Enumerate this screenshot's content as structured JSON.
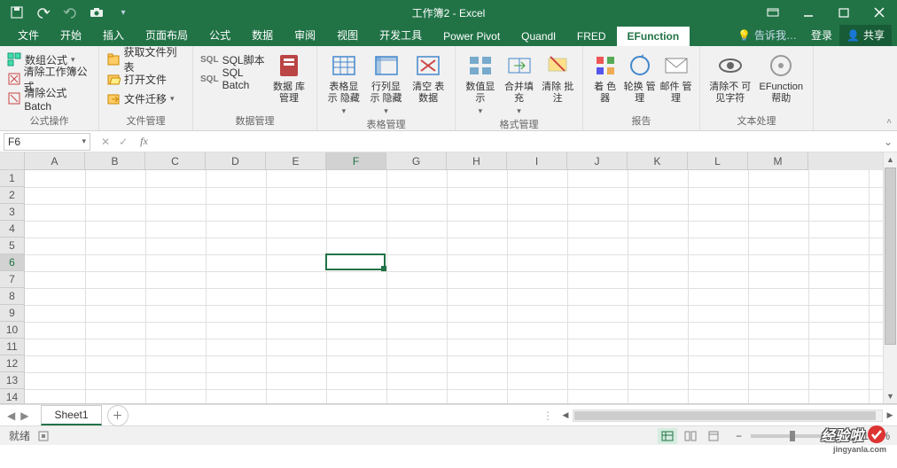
{
  "titlebar": {
    "title": "工作簿2 - Excel"
  },
  "tabs": {
    "file": "文件",
    "home": "开始",
    "insert": "插入",
    "layout": "页面布局",
    "formula": "公式",
    "data": "数据",
    "review": "审阅",
    "view": "视图",
    "dev": "开发工具",
    "powerpivot": "Power Pivot",
    "quandl": "Quandl",
    "fred": "FRED",
    "efunction": "EFunction",
    "tellme": "告诉我…",
    "login": "登录",
    "share": "共享"
  },
  "ribbon": {
    "g1": {
      "b1": "数组公式",
      "b2": "清除工作簿公式",
      "b3": "清除公式Batch",
      "label": "公式操作"
    },
    "g2": {
      "b1": "获取文件列表",
      "b2": "打开文件",
      "b3": "文件迁移",
      "label": "文件管理"
    },
    "g3": {
      "b1": "SQL脚本",
      "b2": "SQL Batch",
      "big": "数据\n库管理",
      "label": "数据管理"
    },
    "g4": {
      "b1": "表格显示\n隐藏",
      "b2": "行列显示\n隐藏",
      "b3": "清空\n表数据",
      "label": "表格管理"
    },
    "g5": {
      "b1": "数值显\n示",
      "b2": "合并填\n充",
      "b3": "清除\n批注",
      "label": "格式管理"
    },
    "g6": {
      "b1": "着\n色器",
      "b2": "轮换\n管理",
      "b3": "邮件\n管理",
      "label": "报告"
    },
    "g7": {
      "b1": "清除不\n可见字符",
      "b2": "EFunction\n帮助",
      "label": "文本处理"
    }
  },
  "namebox": {
    "ref": "F6"
  },
  "columns": [
    "A",
    "B",
    "C",
    "D",
    "E",
    "F",
    "G",
    "H",
    "I",
    "J",
    "K",
    "L",
    "M"
  ],
  "rows": [
    "1",
    "2",
    "3",
    "4",
    "5",
    "6",
    "7",
    "8",
    "9",
    "10",
    "11",
    "12",
    "13",
    "14"
  ],
  "selected": {
    "col": 5,
    "row": 5
  },
  "sheet": {
    "name": "Sheet1"
  },
  "status": {
    "ready": "就绪",
    "zoom": "100%"
  },
  "watermark": "经验啦"
}
